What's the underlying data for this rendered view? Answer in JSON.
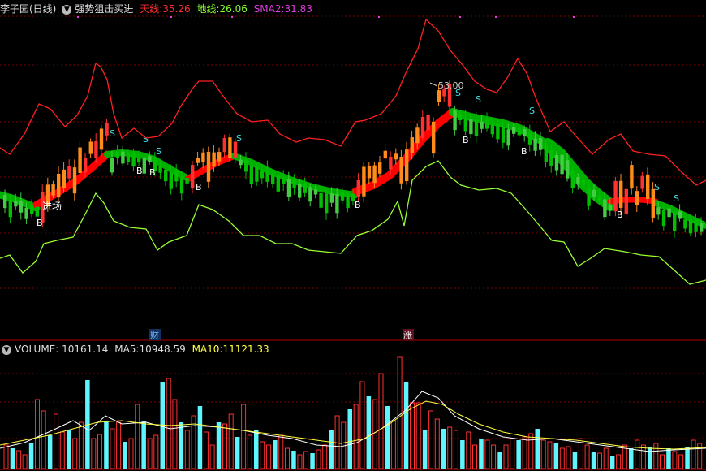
{
  "header": {
    "stock_name": "李子园(日线)",
    "indicator_name": "强势狙击买进",
    "items": [
      {
        "label": "天线:",
        "value": "35.26",
        "color": "#ff3030"
      },
      {
        "label": "地线:",
        "value": "26.06",
        "color": "#88ff30"
      },
      {
        "label": "SMA2:",
        "value": "31.83",
        "color": "#e040e0"
      }
    ]
  },
  "volume_header": {
    "label": "VOLUME:",
    "value": "10161.14",
    "ma5_label": "MA5:",
    "ma5_value": "10948.59",
    "ma10_label": "MA10:",
    "ma10_value": "11121.33"
  },
  "markers": {
    "cai": "财",
    "zhang": "涨",
    "entry": "进场",
    "peak": "53.00"
  },
  "colors": {
    "up": "#ff3030",
    "down": "#00e0e0",
    "sky": "#ff2020",
    "ground": "#99ff33",
    "band_up": "#ff0000",
    "band_down": "#00b000",
    "magenta": "#e040e0"
  },
  "chart_data": {
    "type": "candlestick",
    "signals": [
      {
        "label": "B"
      },
      {
        "label": "S"
      },
      {
        "label": "S"
      },
      {
        "label": "B"
      },
      {
        "label": "S"
      },
      {
        "label": "B"
      },
      {
        "label": "B"
      },
      {
        "label": "S"
      },
      {
        "label": "B"
      },
      {
        "label": "S"
      },
      {
        "label": "S"
      },
      {
        "label": "B"
      },
      {
        "label": "S"
      },
      {
        "label": "B"
      },
      {
        "label": "B"
      },
      {
        "label": "S"
      },
      {
        "label": "S"
      }
    ]
  }
}
